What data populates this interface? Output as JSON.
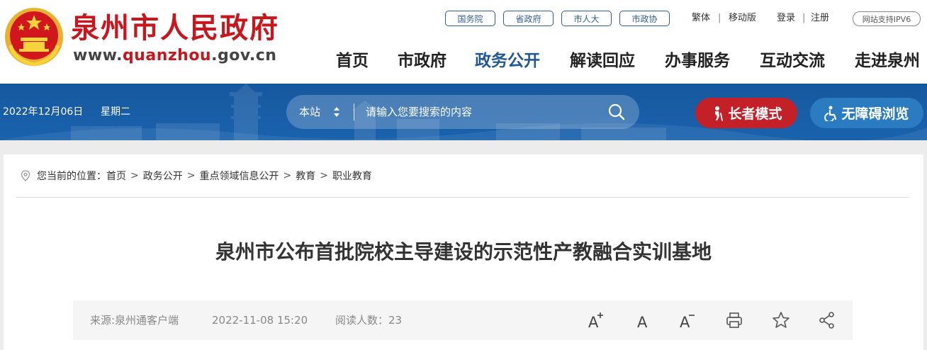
{
  "header": {
    "site_name": "泉州市人民政府",
    "url_prefix": "www.",
    "url_highlight": "quanzhou",
    "url_suffix": ".gov.cn",
    "top_links": [
      "国务院",
      "省政府",
      "市人大",
      "市政协"
    ],
    "lang_label": "繁体",
    "mobile_label": "移动版",
    "login_label": "登录",
    "register_label": "注册",
    "ipv6_label": "网站支持IPV6",
    "nav": [
      "首页",
      "市政府",
      "政务公开",
      "解读回应",
      "办事服务",
      "互动交流",
      "走进泉州"
    ],
    "active_nav": "政务公开"
  },
  "banner": {
    "date": "2022年12月06日",
    "weekday": "星期二",
    "search_scope": "本站",
    "search_placeholder": "请输入您要搜索的内容",
    "elder_mode_label": "长者模式",
    "accessibility_label": "无障碍浏览"
  },
  "breadcrumb": {
    "prefix": "您当前的位置：",
    "items": [
      "首页",
      "政务公开",
      "重点领域信息公开",
      "教育",
      "职业教育"
    ],
    "separator": ">"
  },
  "article": {
    "title": "泉州市公布首批院校主导建设的示范性产教融合实训基地",
    "source": "来源:泉州通客户端",
    "datetime": "2022-11-08 15:20",
    "read_label": "阅读人数：",
    "read_count": "23"
  },
  "colors": {
    "brand_red": "#c8161d",
    "nav_active": "#1f5894",
    "banner_blue": "#1a5da8",
    "elder_red": "#c32127",
    "access_blue": "#2a7bbf"
  },
  "icons": [
    "national-emblem-icon",
    "sort-arrows-icon",
    "search-icon",
    "elder-icon",
    "wheelchair-icon",
    "location-pin-icon",
    "font-increase-icon",
    "font-normal-icon",
    "font-decrease-icon",
    "print-icon",
    "favorite-star-icon",
    "share-icon"
  ]
}
